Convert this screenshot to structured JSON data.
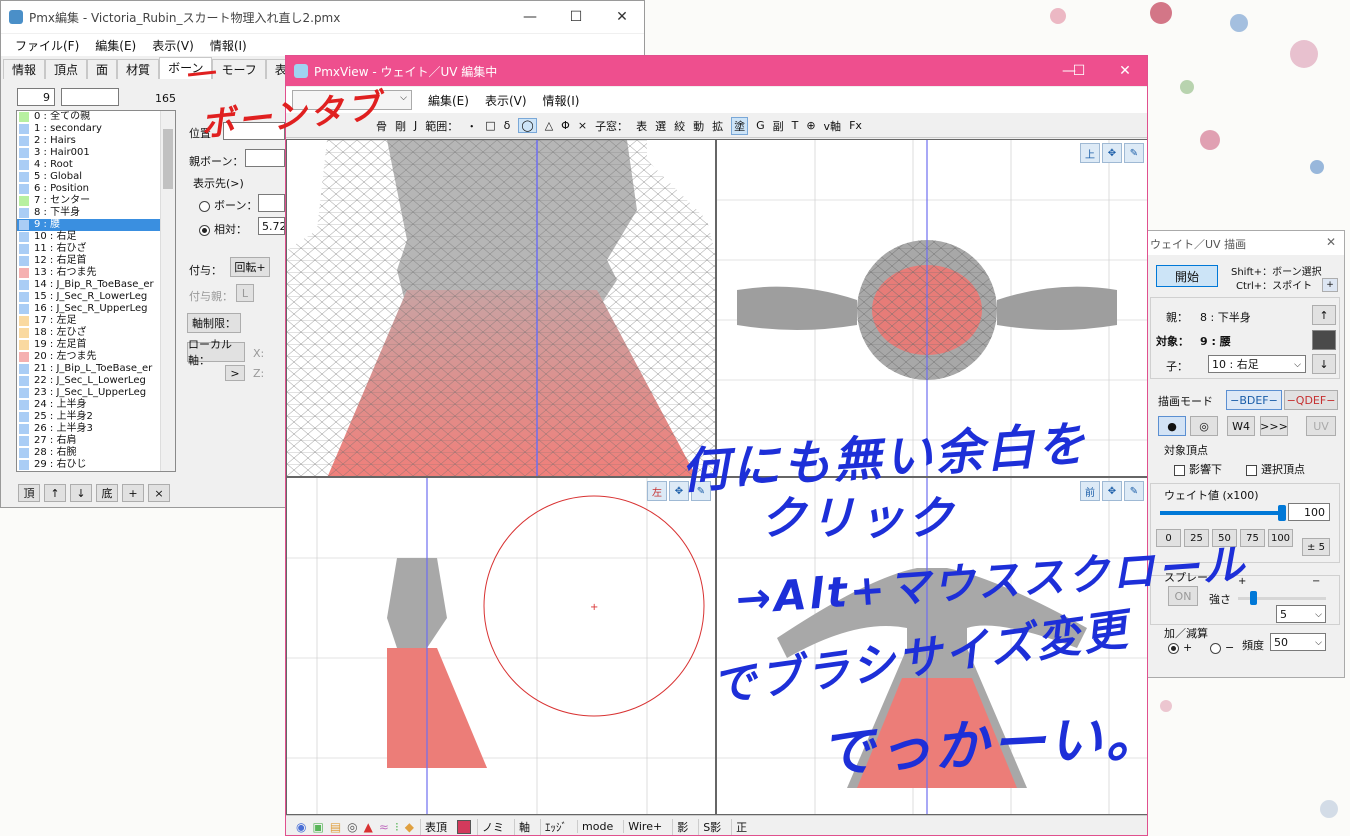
{
  "win1": {
    "title": "Pmx編集 - Victoria_Rubin_スカート物理入れ直し2.pmx",
    "menus": [
      "ファイル(F)",
      "編集(E)",
      "表示(V)",
      "情報(I)"
    ],
    "tabs": [
      "情報",
      "頂点",
      "面",
      "材質",
      "ボーン",
      "モーフ",
      "表示"
    ],
    "index": "9",
    "count": "165",
    "bones": [
      {
        "t": "0 : 全ての親",
        "c": "#b7f0a0"
      },
      {
        "t": "1 : secondary",
        "c": "#aacdf5"
      },
      {
        "t": "2 : Hairs",
        "c": "#aacdf5"
      },
      {
        "t": "3 : Hair001",
        "c": "#aacdf5"
      },
      {
        "t": "4 : Root",
        "c": "#aacdf5"
      },
      {
        "t": "5 : Global",
        "c": "#aacdf5"
      },
      {
        "t": "6 : Position",
        "c": "#aacdf5"
      },
      {
        "t": "7 : センター",
        "c": "#b7f0a0"
      },
      {
        "t": "8 : 下半身",
        "c": "#aacdf5"
      },
      {
        "t": "9 : 腰",
        "c": "#aacdf5",
        "sel": true
      },
      {
        "t": "10 : 右足",
        "c": "#aacdf5"
      },
      {
        "t": "11 : 右ひざ",
        "c": "#aacdf5"
      },
      {
        "t": "12 : 右足首",
        "c": "#aacdf5"
      },
      {
        "t": "13 : 右つま先",
        "c": "#f5b0b0"
      },
      {
        "t": "14 : J_Bip_R_ToeBase_er",
        "c": "#aacdf5"
      },
      {
        "t": "15 : J_Sec_R_LowerLeg",
        "c": "#aacdf5"
      },
      {
        "t": "16 : J_Sec_R_UpperLeg",
        "c": "#aacdf5"
      },
      {
        "t": "17 : 左足",
        "c": "#fad9a0"
      },
      {
        "t": "18 : 左ひざ",
        "c": "#fad9a0"
      },
      {
        "t": "19 : 左足首",
        "c": "#fad9a0"
      },
      {
        "t": "20 : 左つま先",
        "c": "#f5b0b0"
      },
      {
        "t": "21 : J_Bip_L_ToeBase_er",
        "c": "#aacdf5"
      },
      {
        "t": "22 : J_Sec_L_LowerLeg",
        "c": "#aacdf5"
      },
      {
        "t": "23 : J_Sec_L_UpperLeg",
        "c": "#aacdf5"
      },
      {
        "t": "24 : 上半身",
        "c": "#aacdf5"
      },
      {
        "t": "25 : 上半身2",
        "c": "#aacdf5"
      },
      {
        "t": "26 : 上半身3",
        "c": "#aacdf5"
      },
      {
        "t": "27 : 右肩",
        "c": "#aacdf5"
      },
      {
        "t": "28 : 右腕",
        "c": "#aacdf5"
      },
      {
        "t": "29 : 右ひじ",
        "c": "#aacdf5"
      }
    ],
    "bottom_btns": [
      "頂",
      "↑",
      "↓",
      "底",
      "+",
      "×"
    ],
    "props": {
      "pos": "位置",
      "parent": "親ボーン：",
      "disp": "表示先(>)",
      "bone_radio": "ボーン：",
      "rel_radio": "相対：",
      "rel_val": "5.722",
      "fuyo": "付与：",
      "rot": "回転+",
      "fuyo_parent": "付与親：",
      "L": "L",
      "axis": "軸制限：",
      "local": "ローカル軸：",
      "x": "X:",
      "z": "Z:",
      "arrow": ">"
    }
  },
  "win2": {
    "title": "PmxView - ウェイト／UV 編集中",
    "menus": [
      "編集(E)",
      "表示(V)",
      "情報(I)"
    ],
    "toolbar": [
      "骨",
      "剛",
      "J",
      "範囲：",
      "・",
      "□",
      "δ",
      "◯",
      "△",
      "Φ",
      "×",
      "子窓：",
      "表",
      "選",
      "絞",
      "動",
      "拡",
      "塗",
      "G",
      "副",
      "T",
      "⊕",
      "v軸",
      "Fx"
    ],
    "view_labels": {
      "top": "上",
      "left": "左",
      "front": "前"
    },
    "bottom": [
      "表頂",
      "ノミ",
      "軸",
      "ｴｯｼﾞ",
      "mode",
      "Wire+",
      "影",
      "S影",
      "正"
    ]
  },
  "win3": {
    "title": "ウェイト／UV 描画",
    "start": "開始",
    "hint1": "Shift+：ボーン選択",
    "hint2": "Ctrl+：スポイト",
    "plus": "+",
    "parent_lbl": "親：",
    "parent_val": "8 : 下半身",
    "target_lbl": "対象：",
    "target_val": "9 : 腰",
    "child_lbl": "子：",
    "child_val": "10 : 右足",
    "mode_lbl": "描画モード",
    "bdef": "−BDEF−",
    "qdef": "−QDEF−",
    "modes": [
      "●",
      "◎",
      "W4",
      ">>>",
      "UV"
    ],
    "target_vtx": "対象頂点",
    "infl": "影響下",
    "selvtx": "選択頂点",
    "weight_lbl": "ウェイト値 (x100)",
    "weight": "100",
    "presets": [
      "0",
      "25",
      "50",
      "75",
      "100"
    ],
    "pm5": "± 5",
    "spray": "スプレー",
    "spray_plus": "+",
    "spray_minus": "−",
    "on": "ON",
    "strength": "強さ",
    "strength_val": "5",
    "addsub": "加／減算",
    "plus_lbl": "+",
    "minus_lbl": "−",
    "freq": "頻度",
    "freq_val": "50"
  },
  "annotations": {
    "bone_tab": "ボーンタブ",
    "l1": "何にも無い余白を",
    "l2": "クリック",
    "l3": "→Alt+マウススクロール",
    "l4": "でブラシサイズ変更",
    "l5": "でっかーい。"
  }
}
